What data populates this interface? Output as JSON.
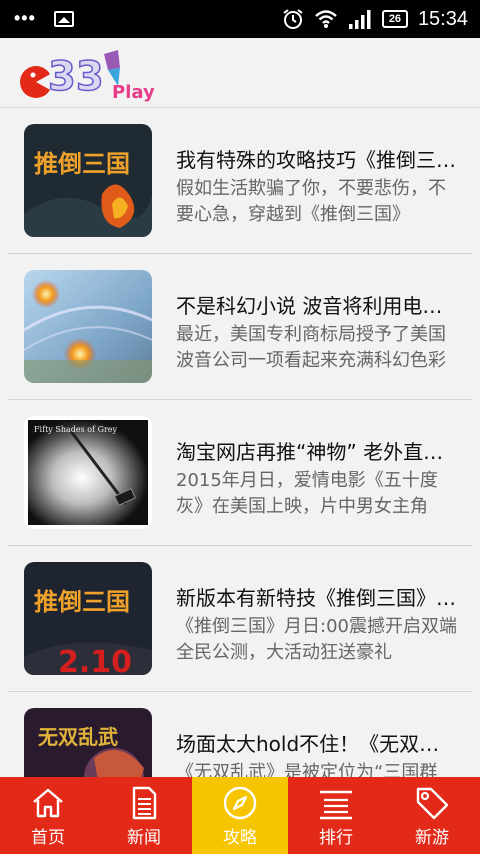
{
  "status_bar": {
    "dots": "•••",
    "battery": "26",
    "time": "15:34"
  },
  "header": {
    "logo_text": "Play!"
  },
  "articles": [
    {
      "title": "我有特殊的攻略技巧《推倒三国》，等你来挑战",
      "desc": "假如生活欺骗了你，不要悲伤，不要心急，穿越到《推倒三国》",
      "thumb_text": "推倒三国"
    },
    {
      "title": "不是科幻小说 波音将利用电磁力场防御冲击波",
      "desc": "最近，美国专利商标局授予了美国波音公司一项看起来充满科幻色彩的专利",
      "thumb_text": ""
    },
    {
      "title": "淘宝网店再推“神物” 老外直呼看不懂",
      "desc": "2015年月日，爱情电影《五十度灰》在美国上映，片中男女主角",
      "thumb_text": "Fifty Shades of Grey"
    },
    {
      "title": "新版本有新特技《推倒三国》震撼开启双端公测",
      "desc": "《推倒三国》月日:00震撼开启双端全民公测，大活动狂送豪礼",
      "thumb_text": "推倒三国"
    },
    {
      "title": "场面太大hold不住！《无双乱武》三国群英传",
      "desc": "《无双乱武》是被定位为“三国群英”题材的一款游戏",
      "thumb_text": "无双乱武"
    }
  ],
  "nav": {
    "tabs": [
      {
        "label": "首页",
        "icon": "home-icon"
      },
      {
        "label": "新闻",
        "icon": "news-document-icon"
      },
      {
        "label": "攻略",
        "icon": "compass-icon"
      },
      {
        "label": "排行",
        "icon": "ranking-list-icon"
      },
      {
        "label": "新游",
        "icon": "tag-icon"
      }
    ],
    "active_index": 2
  },
  "colors": {
    "nav_background": "#e32a19",
    "nav_active": "#f7c500"
  }
}
